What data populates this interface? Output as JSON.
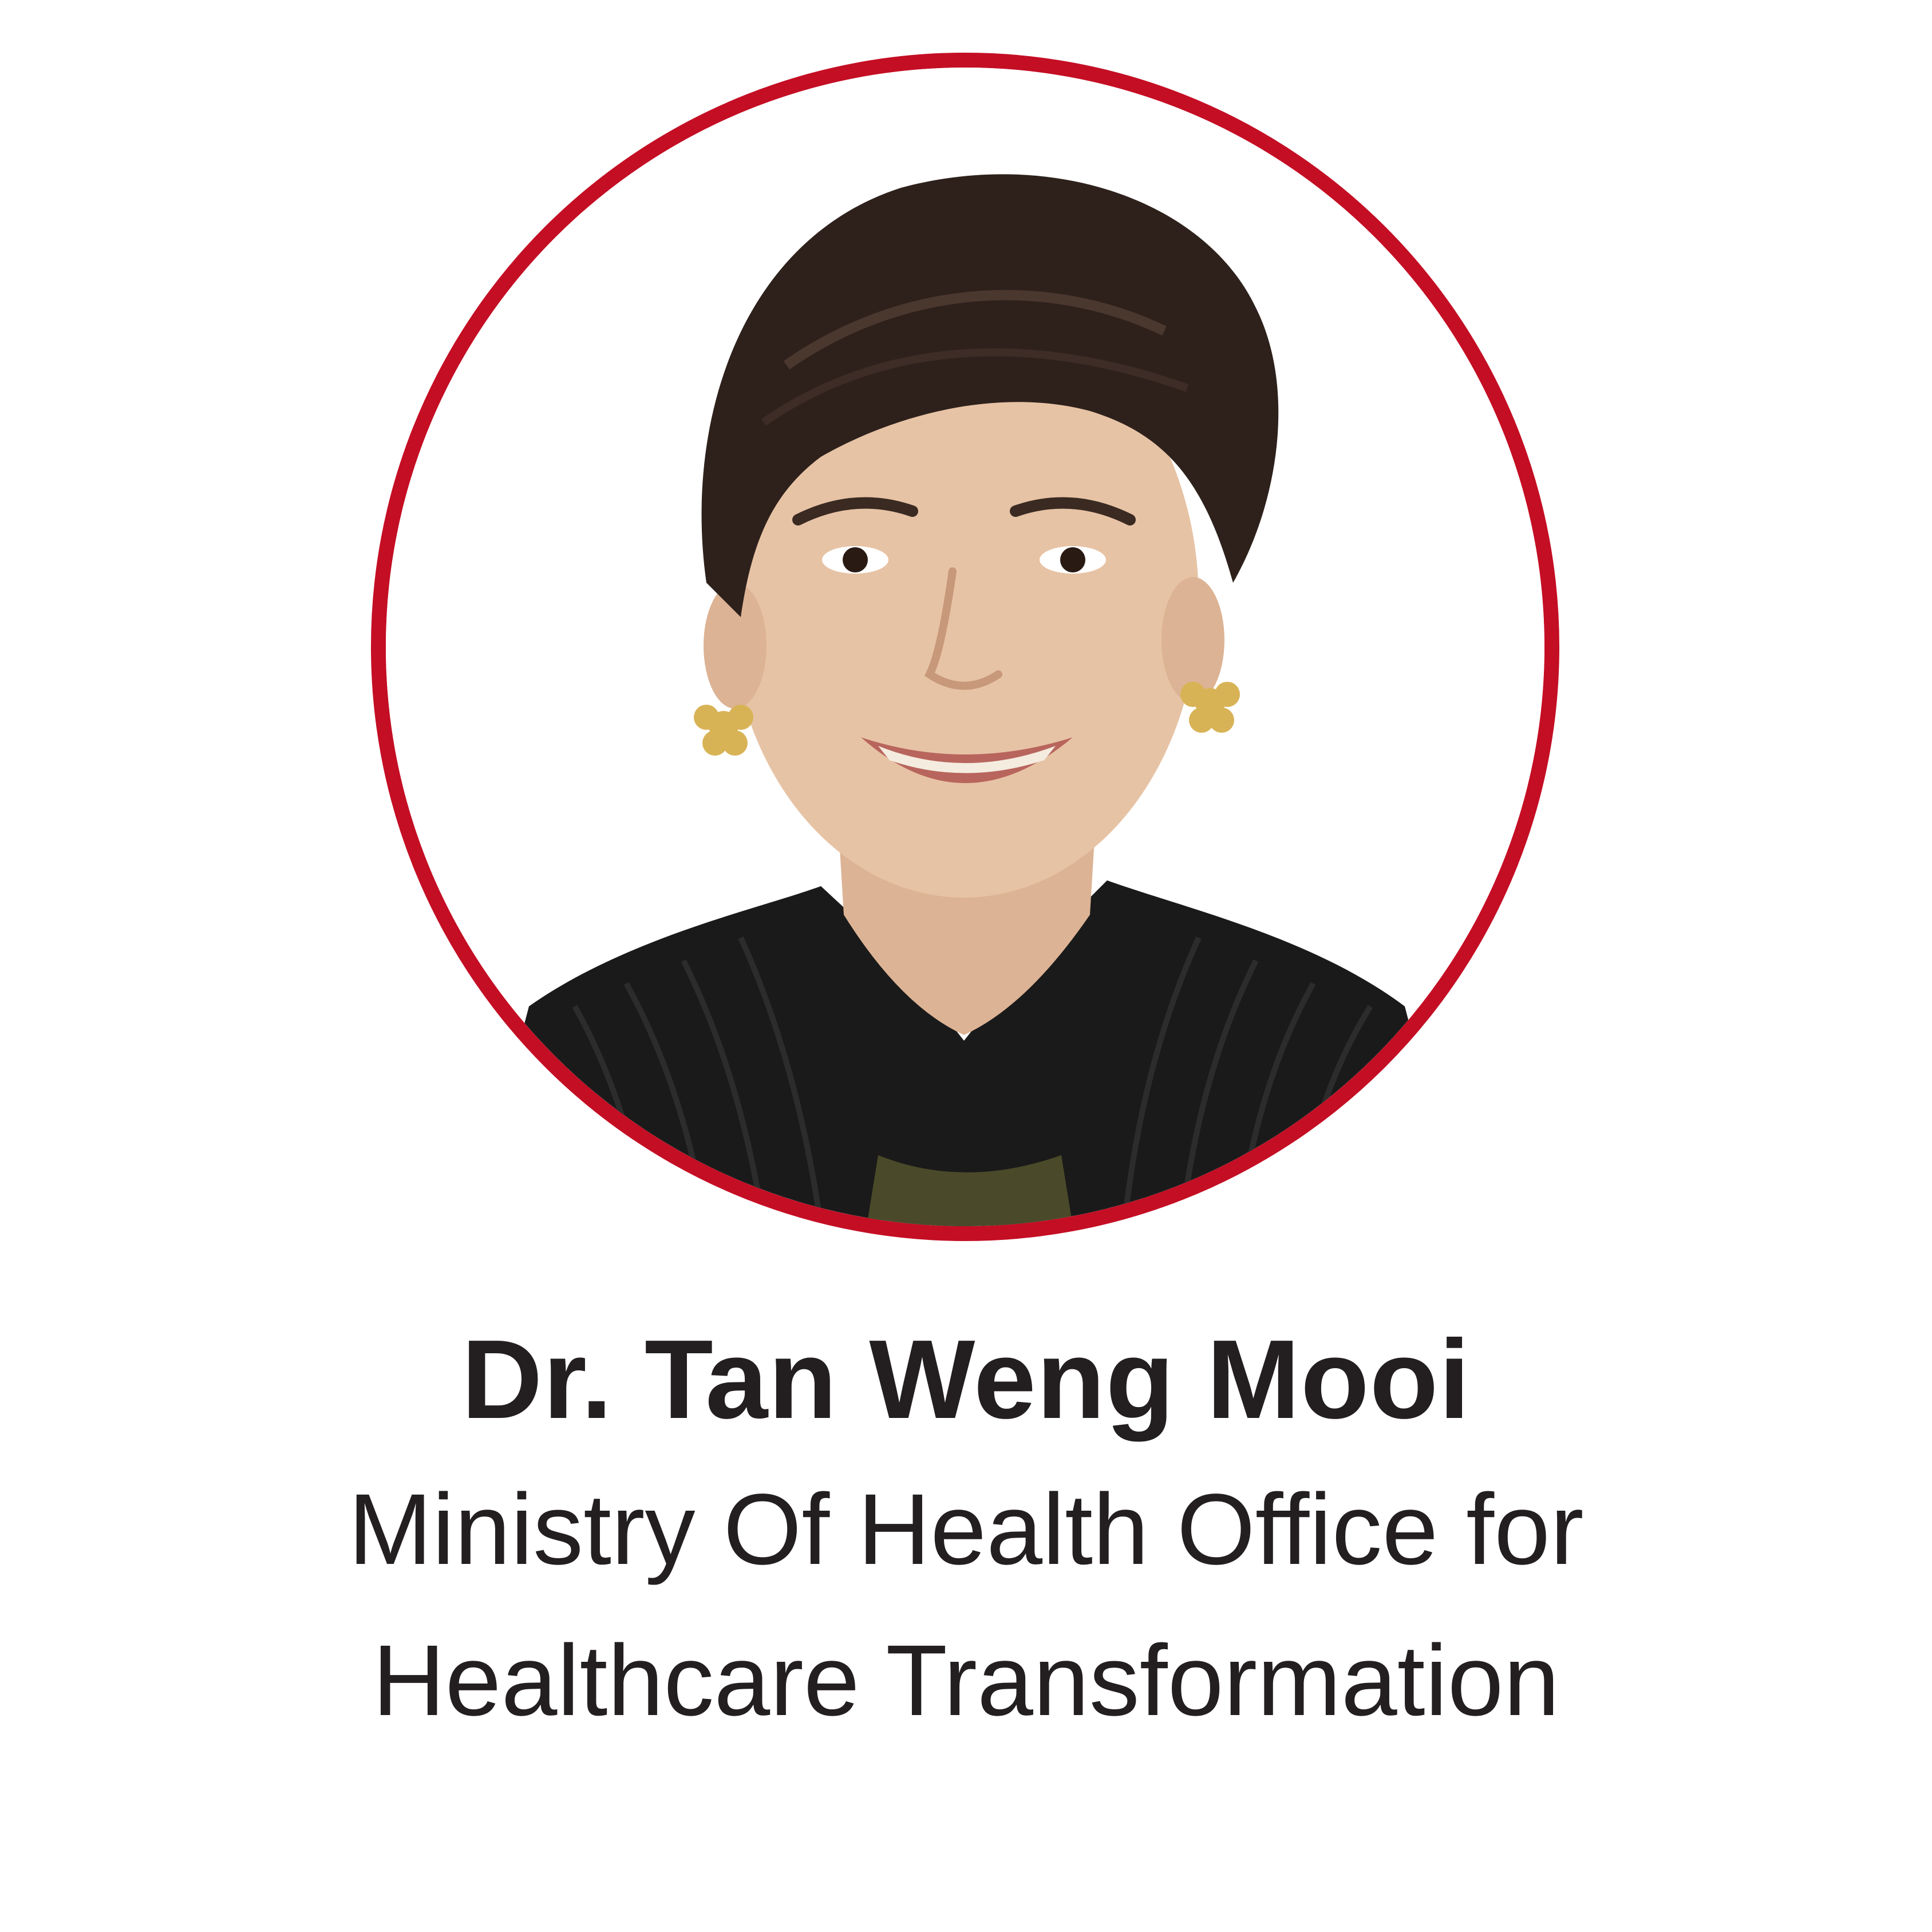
{
  "profile": {
    "name": "Dr. Tan Weng Mooi",
    "affiliation_line1": "Ministry Of Health Office for",
    "affiliation_line2": "Healthcare Transformation",
    "frame_color": "#c40e24",
    "text_color": "#231f20",
    "photo_icon": "portrait-photo"
  }
}
